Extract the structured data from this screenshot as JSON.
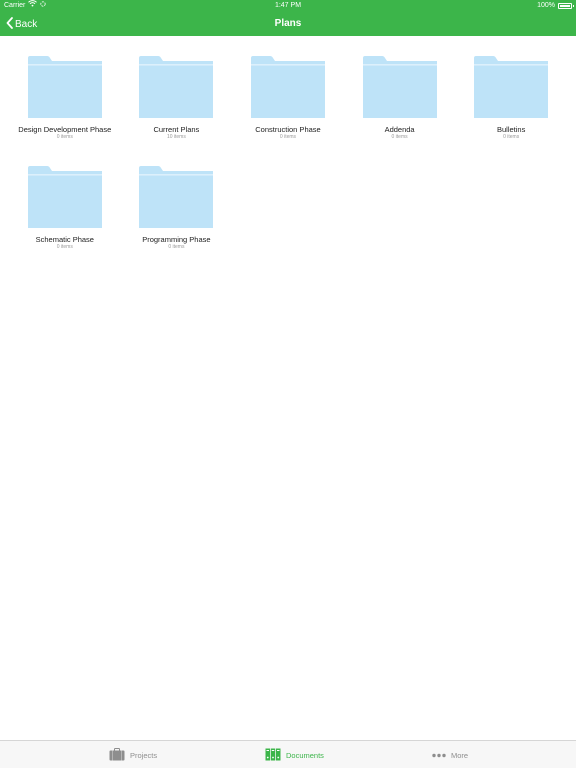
{
  "status_bar": {
    "carrier": "Carrier",
    "time": "1:47 PM",
    "battery": "100%"
  },
  "nav": {
    "back_label": "Back",
    "title": "Plans"
  },
  "folders": [
    {
      "name": "Design Development Phase",
      "count": "0 items"
    },
    {
      "name": "Current Plans",
      "count": "10 items"
    },
    {
      "name": "Construction Phase",
      "count": "0 items"
    },
    {
      "name": "Addenda",
      "count": "0 items"
    },
    {
      "name": "Bulletins",
      "count": "0 items"
    },
    {
      "name": "Schematic Phase",
      "count": "0 items"
    },
    {
      "name": "Programming Phase",
      "count": "0 items"
    }
  ],
  "tab_bar": {
    "projects_label": "Projects",
    "documents_label": "Documents",
    "more_label": "More",
    "active_tab": "documents"
  },
  "colors": {
    "brand_green": "#3cb54a",
    "folder_blue": "#bee3f8",
    "tab_inactive": "#8e8e8e"
  },
  "icons": {
    "back": "chevron-left-icon",
    "wifi": "wifi-icon",
    "activity": "loading-icon",
    "battery": "battery-icon",
    "folder": "folder-icon",
    "projects": "briefcase-icon",
    "documents": "binders-icon",
    "more": "ellipsis-icon"
  }
}
